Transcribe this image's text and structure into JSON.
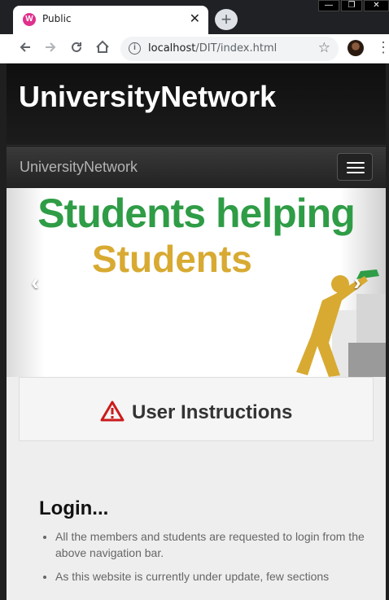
{
  "browser": {
    "tab_title": "Public",
    "tab_close": "✕",
    "new_tab": "+",
    "url_host": "localhost",
    "url_path": "/DIT/index.html",
    "window_controls": [
      "—",
      "❐",
      "✕"
    ]
  },
  "site": {
    "header_title": "UniversityNetwork",
    "navbar_brand": "UniversityNetwork"
  },
  "carousel": {
    "line1": "Students helping",
    "line2": "Students",
    "prev": "‹",
    "next": "›"
  },
  "panel": {
    "title": "User Instructions"
  },
  "content": {
    "heading": "Login...",
    "items": [
      "All the members and students are requested to login from the above navigation bar.",
      "As this website is currently under update, few sections"
    ]
  },
  "colors": {
    "hero_green": "#2f9c46",
    "hero_gold": "#d8aa32",
    "warning_red": "#cc1b1b"
  }
}
